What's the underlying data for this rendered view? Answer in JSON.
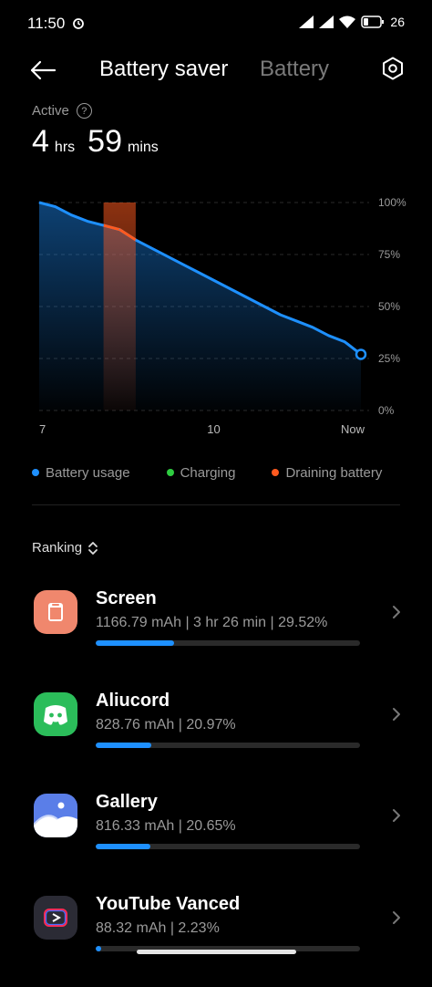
{
  "status_bar": {
    "time": "11:50",
    "battery_percent": "26"
  },
  "header": {
    "tab_active": "Battery saver",
    "tab_inactive": "Battery"
  },
  "summary": {
    "label": "Active",
    "help_glyph": "?",
    "hours": "4",
    "hours_unit": "hrs",
    "minutes": "59",
    "minutes_unit": "mins"
  },
  "chart_data": {
    "type": "area",
    "x_ticks": [
      "7",
      "10",
      "Now"
    ],
    "y_ticks": [
      "100%",
      "75%",
      "50%",
      "25%",
      "0%"
    ],
    "ylim": [
      0,
      100
    ],
    "series": [
      {
        "name": "Battery usage",
        "color": "#1e90ff",
        "x": [
          0,
          0.5,
          1,
          1.5,
          2,
          2.5,
          3,
          3.5,
          4,
          4.5,
          5,
          5.5,
          6,
          6.5,
          7,
          7.5,
          8,
          8.5,
          9,
          9.5,
          10
        ],
        "values": [
          100,
          98,
          94,
          91,
          89,
          87,
          82,
          78,
          74,
          70,
          66,
          62,
          58,
          54,
          50,
          46,
          43,
          40,
          36,
          33,
          27
        ]
      }
    ],
    "draining_band": {
      "x_start": 2,
      "x_end": 3,
      "color": "#ff5a1f"
    },
    "legend": [
      {
        "label": "Battery usage",
        "color": "#1e90ff"
      },
      {
        "label": "Charging",
        "color": "#2ecc40"
      },
      {
        "label": "Draining battery",
        "color": "#ff5a1f"
      }
    ]
  },
  "ranking_label": "Ranking",
  "apps": [
    {
      "name": "Screen",
      "detail": "1166.79 mAh | 3 hr 26 min  | 29.52%",
      "percent": 29.52,
      "icon": "screen-icon",
      "icon_bg": "#f0876d"
    },
    {
      "name": "Aliucord",
      "detail": "828.76 mAh | 20.97%",
      "percent": 20.97,
      "icon": "aliucord-icon",
      "icon_bg": "#2bbd5a"
    },
    {
      "name": "Gallery",
      "detail": "816.33 mAh | 20.65%",
      "percent": 20.65,
      "icon": "gallery-icon",
      "icon_bg": "#5a7ee8"
    },
    {
      "name": "YouTube Vanced",
      "detail": "88.32 mAh | 2.23%",
      "percent": 2.23,
      "icon": "youtube-vanced-icon",
      "icon_bg": "#2b2b35"
    }
  ]
}
